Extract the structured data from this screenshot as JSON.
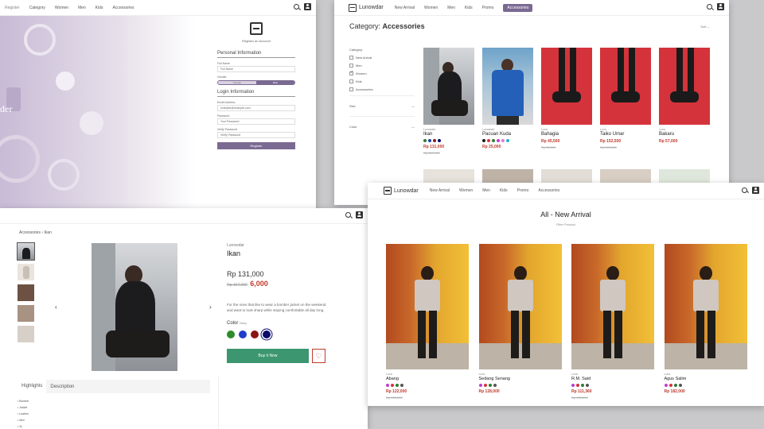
{
  "register": {
    "nav_links": [
      "Register",
      "Category",
      "Women",
      "Men",
      "Kids",
      "Accessories"
    ],
    "hero_title": "der",
    "brand_sub": "Register an Account",
    "personal_heading": "Personal Information",
    "fullname_label": "Full Name",
    "fullname_value": "Full Name",
    "gender_label": "Gender",
    "gender_options": [
      "Female",
      "Male"
    ],
    "login_heading": "Login Information",
    "email_label": "Email Address",
    "email_value": "example@example.com",
    "password_label": "Password",
    "password_value": "Your Password",
    "verify_label": "Verify Password",
    "verify_value": "Verify Password",
    "submit_label": "Register"
  },
  "category": {
    "brand": "Lunowdar",
    "nav_links": [
      "New Arrival",
      "Women",
      "Men",
      "Kids",
      "Promo",
      "Accessories"
    ],
    "title_prefix": "Category:",
    "title_value": "Accessories",
    "sort": "Sort",
    "filter_heading": "Category",
    "filter_options": [
      {
        "label": "New Arrival",
        "checked": false
      },
      {
        "label": "Men",
        "checked": false
      },
      {
        "label": "Women",
        "checked": true
      },
      {
        "label": "Kids",
        "checked": false
      },
      {
        "label": "Accessories",
        "checked": false
      }
    ],
    "size_label": "Size",
    "color_label": "Color",
    "products": [
      {
        "brand": "Lunowdar",
        "name": "Ikan",
        "price": "Rp 131,000",
        "old": "Rp 167,000",
        "colors": [
          "#2d7d32",
          "#1f3ea8",
          "#8b1a1a",
          "#0a0a6b"
        ],
        "photo": "city"
      },
      {
        "brand": "Lunowdar",
        "name": "Pacuan Kuda",
        "price": "Rp 25,000",
        "old": "",
        "colors": [
          "#1a1a1a",
          "#d4333b",
          "#2d7d32",
          "#c23bd4",
          "#e07bd0",
          "#22b5c7"
        ],
        "photo": "street"
      },
      {
        "brand": "Luna",
        "name": "Bahagia",
        "price": "Rp 45,500",
        "old": "Rp 55,000",
        "colors": [],
        "photo": "red"
      },
      {
        "brand": "Luna",
        "name": "Taiko Umar",
        "price": "Rp 152,500",
        "old": "Rp 170,000",
        "colors": [],
        "photo": "red"
      },
      {
        "brand": "Luna",
        "name": "Bakaru",
        "price": "Rp 57,000",
        "old": "",
        "colors": [],
        "photo": "red"
      }
    ]
  },
  "detail": {
    "breadcrumb_home": "Accessories",
    "breadcrumb_current": "Ikan",
    "brand": "Lunowdar",
    "title": "Ikan",
    "price": "Rp 131,000",
    "old_price": "Rp 167,000",
    "sale_price": "6,000",
    "description": "For the ones that like to wear a bomber jacket on the weekend and want to look sharp while staying comfortable all day long.",
    "color_label": "Color",
    "color_value": "Navy",
    "swatches": [
      "#2d8b2a",
      "#1f3ec9",
      "#8b1313",
      "#0a0a6b"
    ],
    "buy_label": "Buy it Now",
    "tabs": [
      "Highlights",
      "Description"
    ],
    "highlights": [
      "Bomber",
      "Jacket",
      "Leather",
      "Men",
      "XL"
    ]
  },
  "arrival": {
    "brand": "Lunowdar",
    "nav_links": [
      "New Arrival",
      "Women",
      "Men",
      "Kids",
      "Promo",
      "Accessories"
    ],
    "title": "All - New Arrival",
    "subtitle": "Filter Product",
    "products": [
      {
        "brand": "Luna",
        "name": "Abang",
        "price": "Rp 122,000",
        "old": "Rp 150,000",
        "colors": [
          "#c23bd4",
          "#d4333b",
          "#2d7d32",
          "#555"
        ]
      },
      {
        "brand": "Luna",
        "name": "Sedang Senang",
        "price": "Rp 128,000",
        "old": "",
        "colors": [
          "#c23bd4",
          "#d4333b",
          "#2d7d32",
          "#555"
        ]
      },
      {
        "brand": "Luna",
        "name": "R.M. Said",
        "price": "Rp 111,360",
        "old": "Rp 139,200",
        "colors": [
          "#c23bd4",
          "#d4333b",
          "#2d7d32",
          "#555"
        ]
      },
      {
        "brand": "Luna",
        "name": "Agus Salim",
        "price": "Rp 182,000",
        "old": "",
        "colors": [
          "#c23bd4",
          "#d4333b",
          "#2d7d32",
          "#555"
        ]
      }
    ]
  },
  "theme": {
    "accent": "#7a6a92",
    "sale": "#c0392b",
    "buy": "#3c9670"
  }
}
